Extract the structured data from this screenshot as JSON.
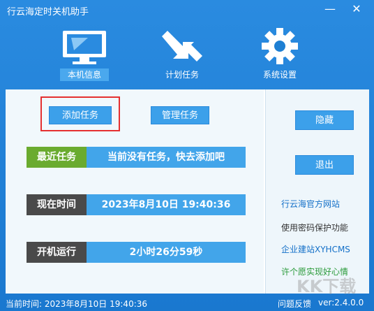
{
  "window": {
    "title": "行云海定时关机助手",
    "minimize": "—",
    "close": "✕"
  },
  "nav": {
    "tabs": [
      {
        "label": "本机信息",
        "icon": "monitor-icon"
      },
      {
        "label": "计划任务",
        "icon": "arrows-icon"
      },
      {
        "label": "系统设置",
        "icon": "gear-icon"
      }
    ]
  },
  "actions": {
    "add_task": "添加任务",
    "manage_task": "管理任务"
  },
  "info": {
    "recent": {
      "label": "最近任务",
      "value": "当前没有任务，快去添加吧"
    },
    "now": {
      "label": "现在时间",
      "value": "2023年8月10日  19:40:36"
    },
    "uptime": {
      "label": "开机运行",
      "value": "2小时26分59秒"
    }
  },
  "side": {
    "hide": "隐藏",
    "exit": "退出",
    "links": [
      "行云海官方网站",
      "使用密码保护功能",
      "企业建站XYHCMS",
      "许个愿实现好心情"
    ]
  },
  "status": {
    "current_time": "当前时间: 2023年8月10日 19:40:36",
    "feedback": "问题反馈",
    "version": "ver:2.4.0.0"
  },
  "watermark": "KK下载",
  "colors": {
    "primary": "#1a78cf",
    "green": "#6aab2f",
    "dark_tag": "#4a4a4a",
    "value_blue": "#42a5ea",
    "link_blue": "#1470c8",
    "link_green": "#2b9b3b",
    "red_box": "#e53030"
  }
}
